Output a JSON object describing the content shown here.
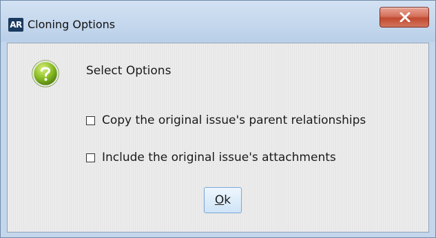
{
  "window": {
    "app_icon_text": "AR",
    "title": "Cloning Options",
    "close_icon": "close-x-icon"
  },
  "dialog": {
    "icon": "question-help-icon",
    "heading": "Select Options",
    "options": [
      {
        "label": "Copy the original issue's parent relationships",
        "checked": false
      },
      {
        "label": "Include the original issue's attachments",
        "checked": false
      }
    ],
    "ok_button": {
      "mnemonic": "O",
      "rest": "k"
    }
  }
}
